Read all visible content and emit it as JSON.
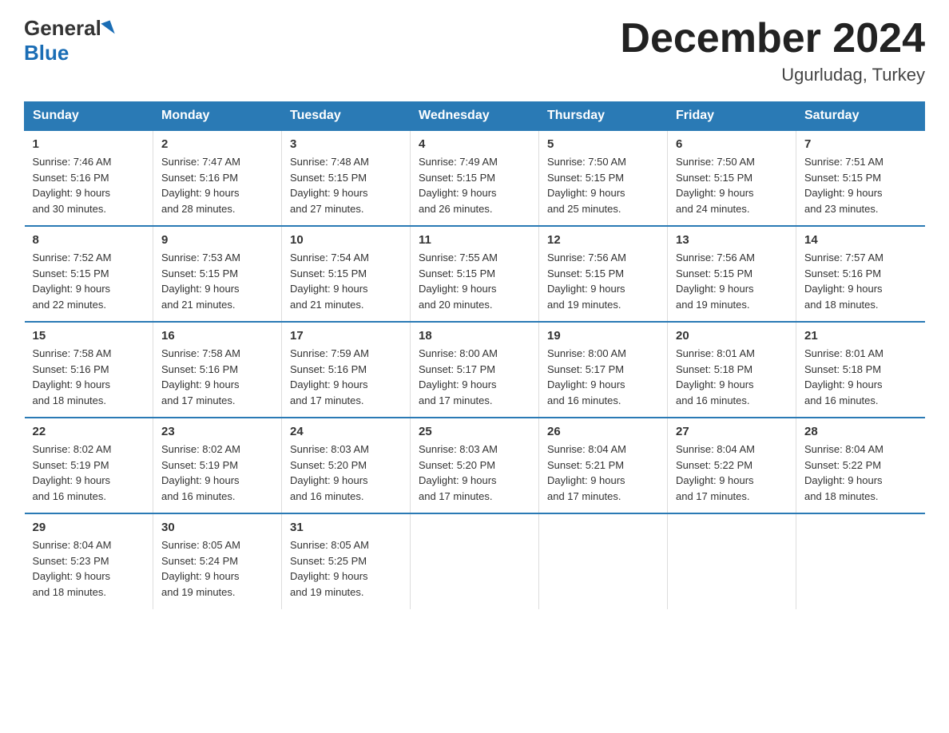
{
  "logo": {
    "general": "General",
    "blue": "Blue"
  },
  "title": "December 2024",
  "location": "Ugurludag, Turkey",
  "days_of_week": [
    "Sunday",
    "Monday",
    "Tuesday",
    "Wednesday",
    "Thursday",
    "Friday",
    "Saturday"
  ],
  "weeks": [
    [
      {
        "day": "1",
        "sunrise": "7:46 AM",
        "sunset": "5:16 PM",
        "daylight": "9 hours and 30 minutes."
      },
      {
        "day": "2",
        "sunrise": "7:47 AM",
        "sunset": "5:16 PM",
        "daylight": "9 hours and 28 minutes."
      },
      {
        "day": "3",
        "sunrise": "7:48 AM",
        "sunset": "5:15 PM",
        "daylight": "9 hours and 27 minutes."
      },
      {
        "day": "4",
        "sunrise": "7:49 AM",
        "sunset": "5:15 PM",
        "daylight": "9 hours and 26 minutes."
      },
      {
        "day": "5",
        "sunrise": "7:50 AM",
        "sunset": "5:15 PM",
        "daylight": "9 hours and 25 minutes."
      },
      {
        "day": "6",
        "sunrise": "7:50 AM",
        "sunset": "5:15 PM",
        "daylight": "9 hours and 24 minutes."
      },
      {
        "day": "7",
        "sunrise": "7:51 AM",
        "sunset": "5:15 PM",
        "daylight": "9 hours and 23 minutes."
      }
    ],
    [
      {
        "day": "8",
        "sunrise": "7:52 AM",
        "sunset": "5:15 PM",
        "daylight": "9 hours and 22 minutes."
      },
      {
        "day": "9",
        "sunrise": "7:53 AM",
        "sunset": "5:15 PM",
        "daylight": "9 hours and 21 minutes."
      },
      {
        "day": "10",
        "sunrise": "7:54 AM",
        "sunset": "5:15 PM",
        "daylight": "9 hours and 21 minutes."
      },
      {
        "day": "11",
        "sunrise": "7:55 AM",
        "sunset": "5:15 PM",
        "daylight": "9 hours and 20 minutes."
      },
      {
        "day": "12",
        "sunrise": "7:56 AM",
        "sunset": "5:15 PM",
        "daylight": "9 hours and 19 minutes."
      },
      {
        "day": "13",
        "sunrise": "7:56 AM",
        "sunset": "5:15 PM",
        "daylight": "9 hours and 19 minutes."
      },
      {
        "day": "14",
        "sunrise": "7:57 AM",
        "sunset": "5:16 PM",
        "daylight": "9 hours and 18 minutes."
      }
    ],
    [
      {
        "day": "15",
        "sunrise": "7:58 AM",
        "sunset": "5:16 PM",
        "daylight": "9 hours and 18 minutes."
      },
      {
        "day": "16",
        "sunrise": "7:58 AM",
        "sunset": "5:16 PM",
        "daylight": "9 hours and 17 minutes."
      },
      {
        "day": "17",
        "sunrise": "7:59 AM",
        "sunset": "5:16 PM",
        "daylight": "9 hours and 17 minutes."
      },
      {
        "day": "18",
        "sunrise": "8:00 AM",
        "sunset": "5:17 PM",
        "daylight": "9 hours and 17 minutes."
      },
      {
        "day": "19",
        "sunrise": "8:00 AM",
        "sunset": "5:17 PM",
        "daylight": "9 hours and 16 minutes."
      },
      {
        "day": "20",
        "sunrise": "8:01 AM",
        "sunset": "5:18 PM",
        "daylight": "9 hours and 16 minutes."
      },
      {
        "day": "21",
        "sunrise": "8:01 AM",
        "sunset": "5:18 PM",
        "daylight": "9 hours and 16 minutes."
      }
    ],
    [
      {
        "day": "22",
        "sunrise": "8:02 AM",
        "sunset": "5:19 PM",
        "daylight": "9 hours and 16 minutes."
      },
      {
        "day": "23",
        "sunrise": "8:02 AM",
        "sunset": "5:19 PM",
        "daylight": "9 hours and 16 minutes."
      },
      {
        "day": "24",
        "sunrise": "8:03 AM",
        "sunset": "5:20 PM",
        "daylight": "9 hours and 16 minutes."
      },
      {
        "day": "25",
        "sunrise": "8:03 AM",
        "sunset": "5:20 PM",
        "daylight": "9 hours and 17 minutes."
      },
      {
        "day": "26",
        "sunrise": "8:04 AM",
        "sunset": "5:21 PM",
        "daylight": "9 hours and 17 minutes."
      },
      {
        "day": "27",
        "sunrise": "8:04 AM",
        "sunset": "5:22 PM",
        "daylight": "9 hours and 17 minutes."
      },
      {
        "day": "28",
        "sunrise": "8:04 AM",
        "sunset": "5:22 PM",
        "daylight": "9 hours and 18 minutes."
      }
    ],
    [
      {
        "day": "29",
        "sunrise": "8:04 AM",
        "sunset": "5:23 PM",
        "daylight": "9 hours and 18 minutes."
      },
      {
        "day": "30",
        "sunrise": "8:05 AM",
        "sunset": "5:24 PM",
        "daylight": "9 hours and 19 minutes."
      },
      {
        "day": "31",
        "sunrise": "8:05 AM",
        "sunset": "5:25 PM",
        "daylight": "9 hours and 19 minutes."
      },
      null,
      null,
      null,
      null
    ]
  ]
}
